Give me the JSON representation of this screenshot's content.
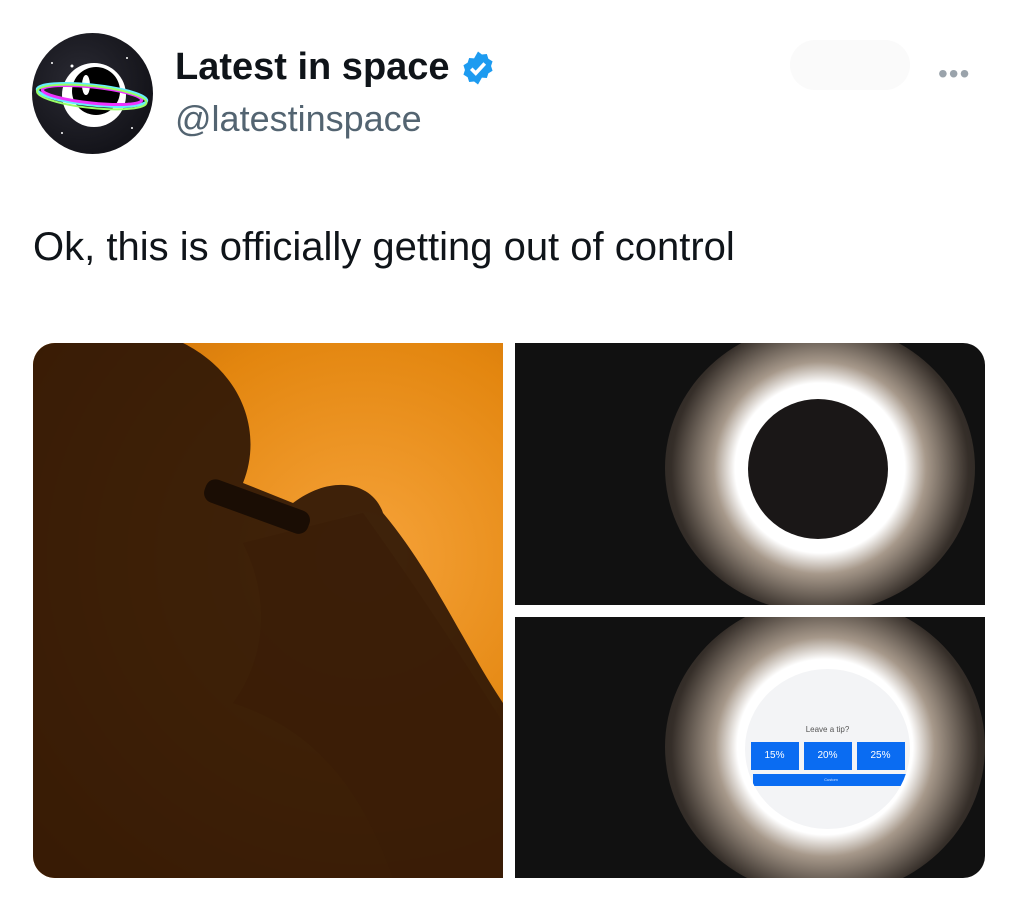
{
  "author": {
    "name": "Latest in space",
    "handle": "@latestinspace",
    "verified": true,
    "badge_color": "#1d9bf0"
  },
  "tweet": {
    "text": "Ok, this is officially getting out of control"
  },
  "more_icon": "ellipsis-icon",
  "tip_prompt": {
    "title": "Leave a tip?",
    "options": [
      "15%",
      "20%",
      "25%"
    ],
    "custom_label": "Custom",
    "button_color": "#0a6cf2"
  }
}
